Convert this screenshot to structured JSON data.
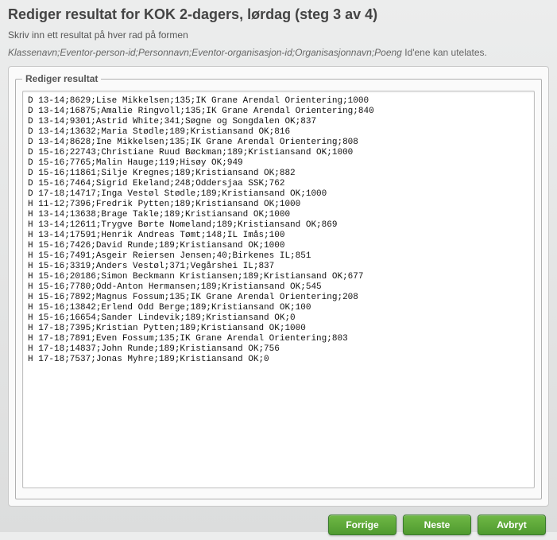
{
  "page_title": "Rediger resultat for KOK 2-dagers, lørdag (steg 3 av 4)",
  "subtitle1": "Skriv inn ett resultat på hver rad på formen",
  "subtitle2_italic": "Klassenavn;Eventor-person-id;Personnavn;Eventor-organisasjon-id;Organisasjonnavn;Poeng",
  "subtitle2_rest": " Id'ene kan utelates.",
  "legend": "Rediger resultat",
  "result_text": "D 13-14;8629;Lise Mikkelsen;135;IK Grane Arendal Orientering;1000\nD 13-14;16875;Amalie Ringvoll;135;IK Grane Arendal Orientering;840\nD 13-14;9301;Astrid White;341;Søgne og Songdalen OK;837\nD 13-14;13632;Maria Stødle;189;Kristiansand OK;816\nD 13-14;8628;Ine Mikkelsen;135;IK Grane Arendal Orientering;808\nD 15-16;22743;Christiane Ruud Bøckman;189;Kristiansand OK;1000\nD 15-16;7765;Malin Hauge;119;Hisøy OK;949\nD 15-16;11861;Silje Kregnes;189;Kristiansand OK;882\nD 15-16;7464;Sigrid Ekeland;248;Oddersjaa SSK;762\nD 17-18;14717;Inga Vestøl Stødle;189;Kristiansand OK;1000\nH 11-12;7396;Fredrik Pytten;189;Kristiansand OK;1000\nH 13-14;13638;Brage Takle;189;Kristiansand OK;1000\nH 13-14;12611;Trygve Børte Nomeland;189;Kristiansand OK;869\nH 13-14;17591;Henrik Andreas Tømt;148;IL Imås;100\nH 15-16;7426;David Runde;189;Kristiansand OK;1000\nH 15-16;7491;Asgeir Reiersen Jensen;40;Birkenes IL;851\nH 15-16;3319;Anders Vestøl;371;Vegårshei IL;837\nH 15-16;20186;Simon Beckmann Kristiansen;189;Kristiansand OK;677\nH 15-16;7780;Odd-Anton Hermansen;189;Kristiansand OK;545\nH 15-16;7892;Magnus Fossum;135;IK Grane Arendal Orientering;208\nH 15-16;13842;Erlend Odd Berge;189;Kristiansand OK;100\nH 15-16;16654;Sander Lindevik;189;Kristiansand OK;0\nH 17-18;7395;Kristian Pytten;189;Kristiansand OK;1000\nH 17-18;7891;Even Fossum;135;IK Grane Arendal Orientering;803\nH 17-18;14837;John Runde;189;Kristiansand OK;756\nH 17-18;7537;Jonas Myhre;189;Kristiansand OK;0",
  "buttons": {
    "prev": "Forrige",
    "next": "Neste",
    "cancel": "Avbryt"
  }
}
